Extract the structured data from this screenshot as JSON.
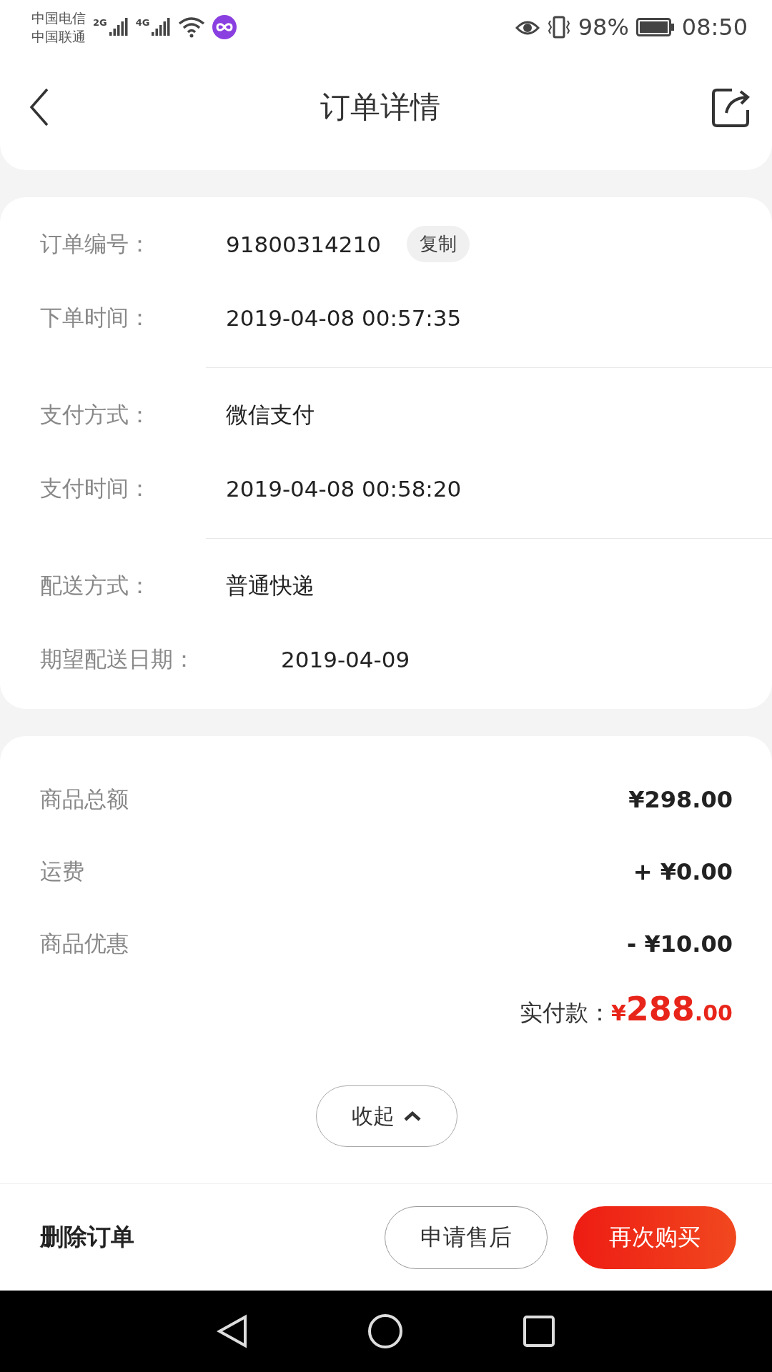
{
  "status_bar": {
    "carriers": [
      "中国电信",
      "中国联通"
    ],
    "signals": [
      "2G",
      "4G"
    ],
    "battery": "98%",
    "time": "08:50"
  },
  "header": {
    "title": "订单详情"
  },
  "order_info": {
    "groups": [
      [
        {
          "label": "订单编号：",
          "value": "91800314210",
          "action": "复制"
        },
        {
          "label": "下单时间：",
          "value": "2019-04-08 00:57:35"
        }
      ],
      [
        {
          "label": "支付方式：",
          "value": "微信支付"
        },
        {
          "label": "支付时间：",
          "value": "2019-04-08 00:58:20"
        }
      ],
      [
        {
          "label": "配送方式：",
          "value": "普通快递"
        },
        {
          "label": "期望配送日期：",
          "value": "2019-04-09",
          "kind": "wide"
        }
      ]
    ]
  },
  "costs": {
    "items": [
      {
        "label": "商品总额",
        "amount": "¥298.00"
      },
      {
        "label": "运费",
        "amount": "+ ¥0.00"
      },
      {
        "label": "商品优惠",
        "amount": "- ¥10.00"
      }
    ],
    "total": {
      "label": "实付款：",
      "currency": "¥",
      "integer": "288",
      "decimals": ".00"
    },
    "collapse": "收起"
  },
  "bottom_bar": {
    "delete": "删除订单",
    "buttons": [
      {
        "label": "申请售后",
        "kind": "outline"
      },
      {
        "label": "再次购买",
        "kind": "primary"
      }
    ]
  }
}
